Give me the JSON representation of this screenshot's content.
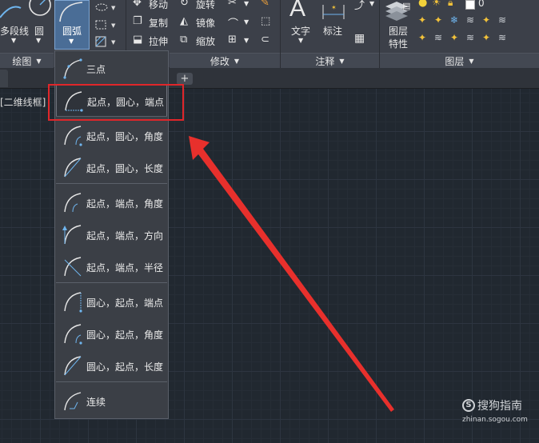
{
  "ribbon": {
    "draw_items": {
      "polyline": "多段线",
      "circle": "圆",
      "arc": "圆弧"
    },
    "modify_items": {
      "move": "移动",
      "rotate": "旋转",
      "copy": "复制",
      "mirror": "镜像",
      "stretch": "拉伸",
      "scale": "缩放"
    },
    "annotate_items": {
      "text": "文字",
      "dimension": "标注"
    },
    "layer_items": {
      "layer_properties_line1": "图层",
      "layer_properties_line2": "特性",
      "current_layer": "0"
    },
    "panels": {
      "draw": "绘图",
      "modify": "修改",
      "annotate": "注释",
      "layers": "图层"
    }
  },
  "tabs": {
    "add_tab": "+"
  },
  "viewport": {
    "label": "[二维线框]"
  },
  "arc_menu": {
    "items": [
      {
        "label": "三点",
        "icon": "arc-3point-icon"
      },
      {
        "label": "起点，圆心，端点",
        "icon": "arc-start-center-end-icon"
      },
      {
        "label": "起点，圆心，角度",
        "icon": "arc-start-center-angle-icon"
      },
      {
        "label": "起点，圆心，长度",
        "icon": "arc-start-center-length-icon"
      },
      {
        "label": "起点，端点，角度",
        "icon": "arc-start-end-angle-icon"
      },
      {
        "label": "起点，端点，方向",
        "icon": "arc-start-end-direction-icon"
      },
      {
        "label": "起点，端点，半径",
        "icon": "arc-start-end-radius-icon"
      },
      {
        "label": "圆心，起点，端点",
        "icon": "arc-center-start-end-icon"
      },
      {
        "label": "圆心，起点，角度",
        "icon": "arc-center-start-angle-icon"
      },
      {
        "label": "圆心，起点，长度",
        "icon": "arc-center-start-length-icon"
      },
      {
        "label": "连续",
        "icon": "arc-continue-icon"
      }
    ]
  },
  "watermark": {
    "brand": "搜狗指南",
    "url": "zhinan.sogou.com"
  },
  "colors": {
    "highlight": "#e0262a",
    "arrow": "#e8302c",
    "accent": "#4aa3e8"
  }
}
